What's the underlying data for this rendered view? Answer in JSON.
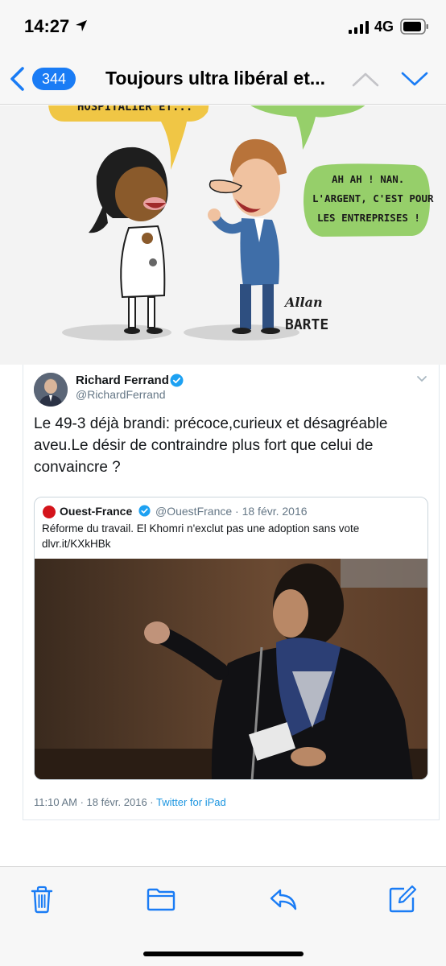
{
  "status_bar": {
    "time": "14:27",
    "network": "4G",
    "icons": [
      "location-arrow-icon",
      "signal-bars-icon",
      "battery-icon"
    ]
  },
  "nav": {
    "back_count": "344",
    "title": "Toujours ultra libéral et...",
    "icons": [
      "chevron-left-icon",
      "chevron-up-icon",
      "chevron-down-icon"
    ]
  },
  "cartoon": {
    "bubble_left_text": "HOSPITALIER ET...",
    "bubble_right_line1": "AH AH ! NAN.",
    "bubble_right_line2": "L'ARGENT, C'EST POUR",
    "bubble_right_line3": "LES ENTREPRISES !",
    "signature_line1": "Allan",
    "signature_line2": "BARTE"
  },
  "tweet": {
    "author_name": "Richard Ferrand",
    "author_handle": "@RichardFerrand",
    "text": "Le 49-3 déjà brandi: précoce,curieux et désagréable aveu.Le désir de contraindre plus fort que celui de convaincre ?",
    "quoted": {
      "author_name": "Ouest-France",
      "author_handle": "@OuestFrance",
      "separator": "·",
      "date": "18 févr. 2016",
      "text": "Réforme du travail. El Khomri n'exclut pas une adoption sans vote dlvr.it/KXkHBk"
    },
    "timestamp": "11:10 AM · 18 févr. 2016 · ",
    "source": "Twitter for iPad"
  },
  "toolbar": {
    "icons": [
      "trash-icon",
      "folder-icon",
      "reply-icon",
      "compose-icon"
    ]
  },
  "colors": {
    "accent": "#1a7cf5",
    "twitter_blue": "#1b95e0",
    "bubble_yellow": "#f0c645",
    "bubble_green": "#96cf6a"
  }
}
